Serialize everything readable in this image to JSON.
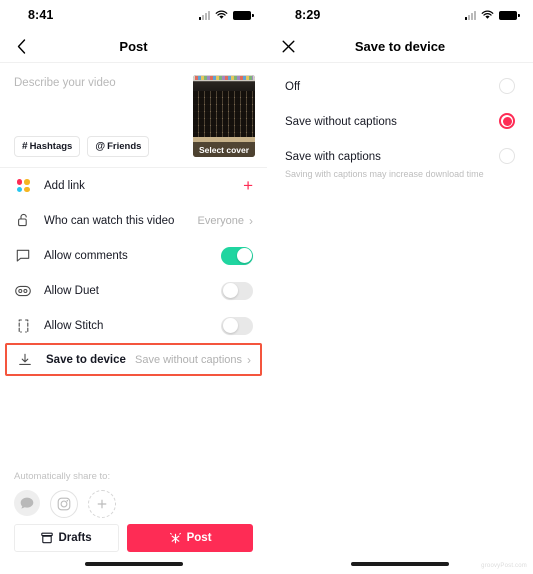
{
  "left_screen": {
    "status": {
      "time": "8:41",
      "signal_icon": "cellular-bars-icon",
      "wifi_icon": "wifi-icon",
      "battery_icon": "battery-icon"
    },
    "nav": {
      "back_icon": "chevron-left-icon",
      "title": "Post"
    },
    "compose": {
      "description_placeholder": "Describe your video",
      "chips": [
        {
          "glyph": "#",
          "label": "Hashtags",
          "name": "hashtags-chip"
        },
        {
          "glyph": "@",
          "label": "Friends",
          "name": "friends-chip"
        }
      ],
      "cover": {
        "label": "Select cover",
        "alt": "laptop-keyboard-thumbnail"
      }
    },
    "rows": [
      {
        "icon": "dot-grid-icon",
        "label": "Add link",
        "value": "",
        "control": "plus",
        "name": "row-add-link"
      },
      {
        "icon": "unlock-icon",
        "label": "Who can watch this video",
        "value": "Everyone",
        "control": "chevron",
        "name": "row-who-can-watch"
      },
      {
        "icon": "comment-icon",
        "label": "Allow comments",
        "value": "",
        "control": "toggle-on",
        "name": "row-allow-comments"
      },
      {
        "icon": "duet-icon",
        "label": "Allow Duet",
        "value": "",
        "control": "toggle-off",
        "name": "row-allow-duet"
      },
      {
        "icon": "stitch-icon",
        "label": "Allow Stitch",
        "value": "",
        "control": "toggle-off",
        "name": "row-allow-stitch"
      },
      {
        "icon": "download-icon",
        "label": "Save to device",
        "value": "Save without captions",
        "control": "chevron",
        "name": "row-save-to-device",
        "highlighted": true
      }
    ],
    "share": {
      "title": "Automatically share to:",
      "targets": [
        {
          "icon": "message-bubble-icon",
          "style": "filled",
          "name": "share-messages"
        },
        {
          "icon": "instagram-icon",
          "style": "outlined",
          "name": "share-instagram"
        },
        {
          "icon": "add-more-icon",
          "style": "dashed",
          "name": "share-add-more"
        }
      ]
    },
    "buttons": {
      "drafts": {
        "label": "Drafts",
        "icon": "drafts-icon"
      },
      "post": {
        "label": "Post",
        "icon": "sparkle-icon"
      }
    }
  },
  "right_screen": {
    "status": {
      "time": "8:29",
      "signal_icon": "cellular-bars-icon",
      "wifi_icon": "wifi-icon",
      "battery_icon": "battery-icon"
    },
    "nav": {
      "close_icon": "close-icon",
      "title": "Save to device"
    },
    "options": [
      {
        "label": "Off",
        "sub": "",
        "selected": false,
        "name": "option-off"
      },
      {
        "label": "Save without captions",
        "sub": "",
        "selected": true,
        "name": "option-save-without-captions"
      },
      {
        "label": "Save with captions",
        "sub": "Saving with captions may increase download time",
        "selected": false,
        "name": "option-save-with-captions"
      }
    ],
    "watermark": "groovyPost.com"
  },
  "colors": {
    "accent_red": "#fe2c55",
    "highlight_border": "#f4553d",
    "toggle_on_green": "#20d5a0"
  }
}
